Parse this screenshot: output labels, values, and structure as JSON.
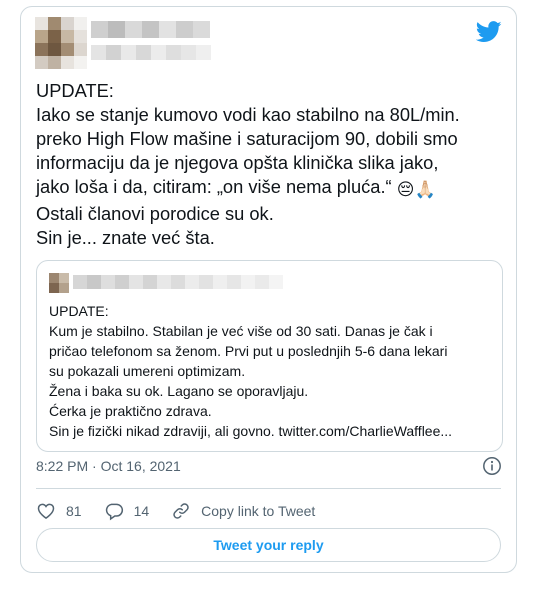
{
  "tweet": {
    "lines": [
      "UPDATE:",
      "Iako se stanje kumovo vodi kao stabilno na 80L/min.",
      "preko High Flow mašine i saturacijom 90, dobili smo",
      "informaciju da je njegova opšta klinička slika jako,",
      "jako loša i da, citiram: „on više nema pluća.“"
    ],
    "emojis": [
      "😔",
      "🙏🏻"
    ],
    "lines_after": [
      "Ostali članovi porodice su ok.",
      "Sin je... znate već šta."
    ]
  },
  "quote": {
    "text": "UPDATE:\nKum je stabilno. Stabilan je već više od 30 sati. Danas je čak i\npričao telefonom sa ženom. Prvi put u poslednjih 5-6 dana lekari\nsu pokazali umereni optimizam.\nŽena i baka su ok. Lagano se oporavljaju.\nĆerka je praktično zdrava.\nSin je fizički nikad zdraviji, ali govno. twitter.com/CharlieWafflee..."
  },
  "meta": {
    "time": "8:22 PM",
    "sep": "·",
    "date": "Oct 16, 2021"
  },
  "actions": {
    "likes": "81",
    "replies": "14",
    "copy_link": "Copy link to Tweet"
  },
  "reply_button": "Tweet your reply",
  "colors": {
    "twitter_blue": "#1d9bf0",
    "border": "#cfd9de",
    "muted": "#536471"
  }
}
